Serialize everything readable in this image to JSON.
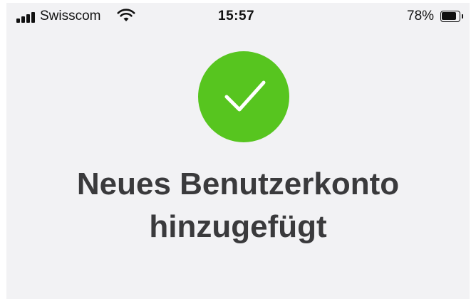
{
  "status_bar": {
    "carrier": "Swisscom",
    "time": "15:57",
    "battery_percent_label": "78%",
    "battery_level": 0.78,
    "signal_icon": "signal-bars-icon",
    "wifi_icon": "wifi-icon",
    "battery_icon": "battery-icon"
  },
  "success": {
    "icon": "checkmark-icon",
    "color": "#57c51f",
    "title_line_1": "Neues Benutzerkonto",
    "title_line_2": "hinzugefügt"
  }
}
